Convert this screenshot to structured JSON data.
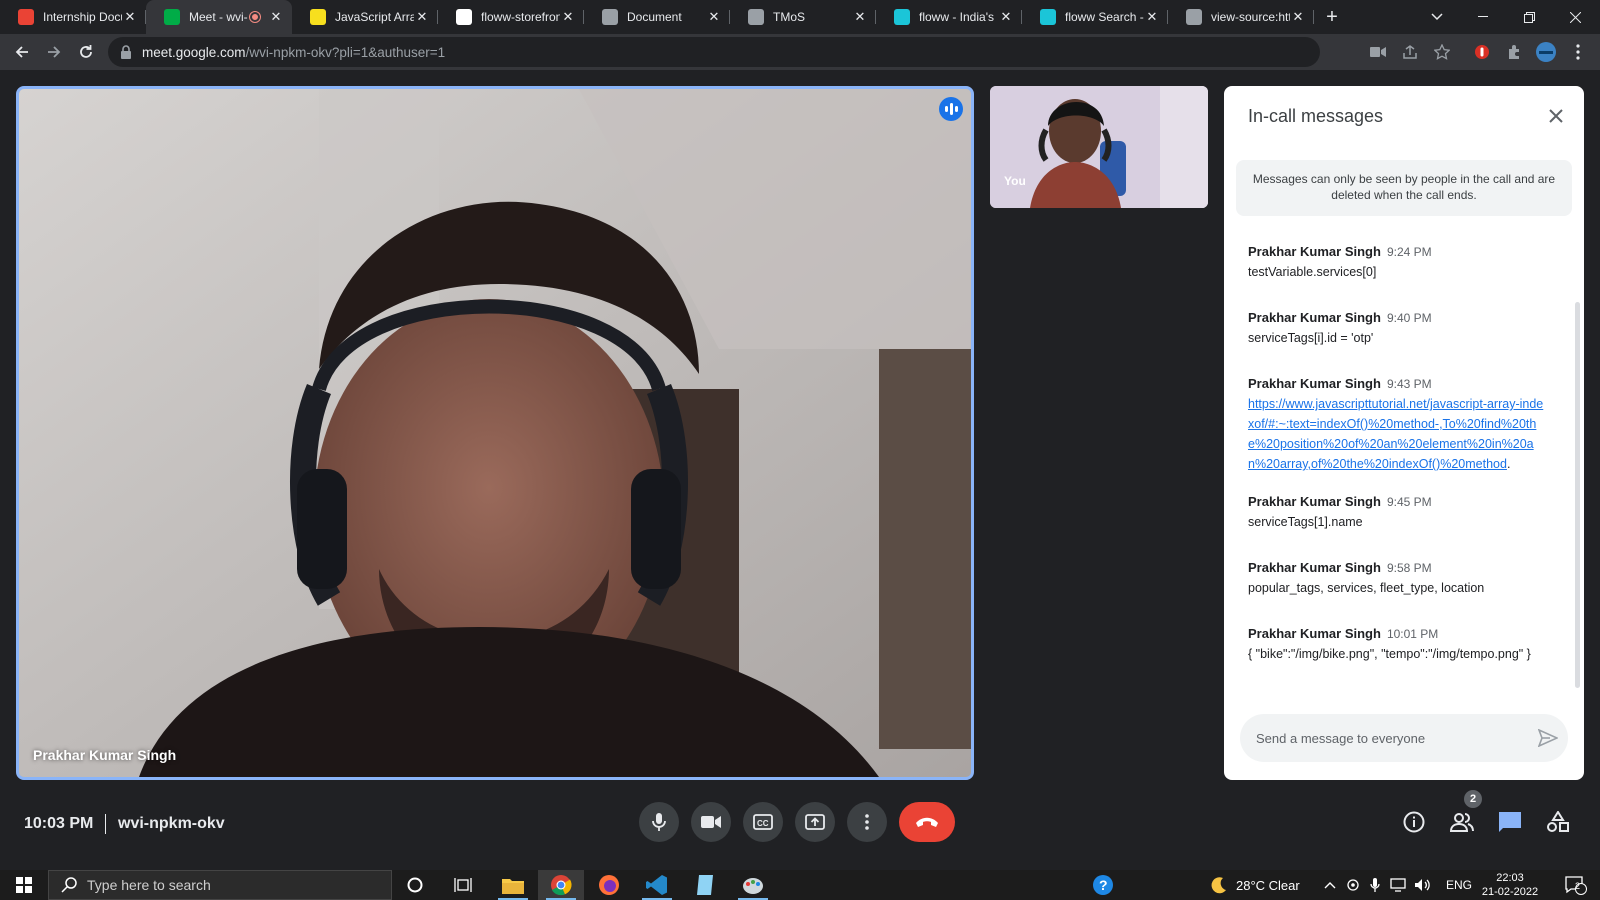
{
  "browser": {
    "tabs": [
      {
        "title": "Internship Docu",
        "favicon": "gmail-icon",
        "color": "#ea4335"
      },
      {
        "title": "Meet - wvi-",
        "favicon": "meet-icon",
        "color": "#00ac47",
        "active": true,
        "recording": true
      },
      {
        "title": "JavaScript Array",
        "favicon": "js-icon",
        "color": "#f7df1e"
      },
      {
        "title": "floww-storefron",
        "favicon": "github-icon",
        "color": "#ffffff"
      },
      {
        "title": "Document",
        "favicon": "globe-icon",
        "color": "#9aa0a6"
      },
      {
        "title": "TMoS",
        "favicon": "globe-icon",
        "color": "#9aa0a6"
      },
      {
        "title": "floww - India's",
        "favicon": "floww-icon",
        "color": "#1bc5d8"
      },
      {
        "title": "floww Search -",
        "favicon": "floww-icon",
        "color": "#1bc5d8"
      },
      {
        "title": "view-source:htt",
        "favicon": "globe-icon",
        "color": "#9aa0a6"
      }
    ],
    "url_host": "meet.google.com",
    "url_path": "/wvi-npkm-okv?pli=1&authuser=1"
  },
  "meeting": {
    "main_speaker": "Prakhar Kumar Singh",
    "self_label": "You",
    "time": "10:03 PM",
    "code": "wvi-npkm-okv",
    "participants_count": "2"
  },
  "chat": {
    "title": "In-call messages",
    "notice": "Messages can only be seen by people in the call and are deleted when the call ends.",
    "placeholder": "Send a message to everyone",
    "messages": [
      {
        "sender": "Prakhar Kumar Singh",
        "time": "9:24 PM",
        "text": "testVariable.services[0]"
      },
      {
        "sender": "Prakhar Kumar Singh",
        "time": "9:40 PM",
        "text": "serviceTags[i].id = 'otp'"
      },
      {
        "sender": "Prakhar Kumar Singh",
        "time": "9:43 PM",
        "link": "https://www.javascripttutorial.net/javascript-array-indexof/#:~:text=indexOf()%20method-,To%20find%20the%20position%20of%20an%20element%20in%20an%20array,of%20the%20indexOf()%20method",
        "text": "."
      },
      {
        "sender": "Prakhar Kumar Singh",
        "time": "9:45 PM",
        "text": "serviceTags[1].name"
      },
      {
        "sender": "Prakhar Kumar Singh",
        "time": "9:58 PM",
        "text": "popular_tags, services, fleet_type, location"
      },
      {
        "sender": "Prakhar Kumar Singh",
        "time": "10:01 PM",
        "text": "{ \"bike\":\"/img/bike.png\", \"tempo\":\"/img/tempo.png\" }"
      }
    ]
  },
  "taskbar": {
    "search_placeholder": "Type here to search",
    "weather": "28°C  Clear",
    "lang": "ENG",
    "clock_time": "22:03",
    "clock_date": "21-02-2022",
    "notif_count": "2"
  }
}
